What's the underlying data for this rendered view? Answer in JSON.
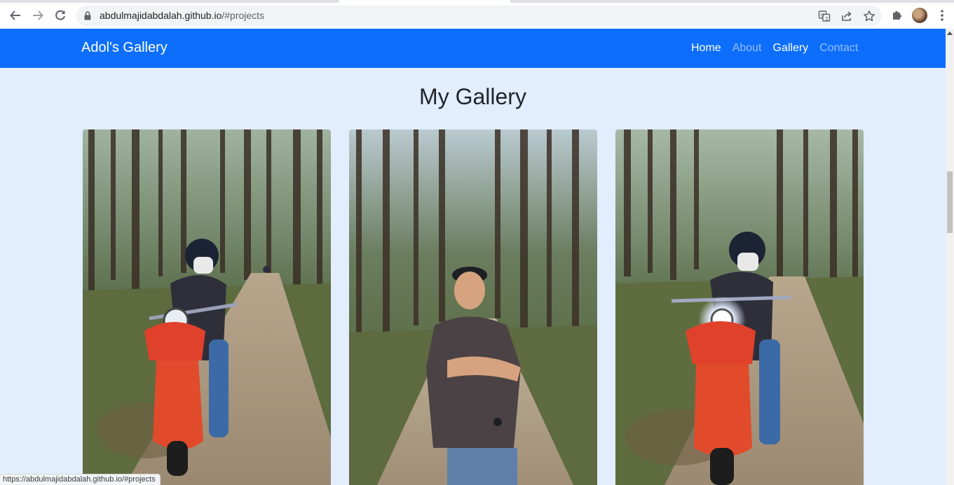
{
  "browser": {
    "url_host": "abdulmajidabdalah.github.io",
    "url_path": "/#projects",
    "status_url": "https://abdulmajidabdalah.github.io/#projects"
  },
  "site": {
    "brand": "Adol's Gallery",
    "nav": [
      {
        "label": "Home",
        "active": true
      },
      {
        "label": "About",
        "active": false
      },
      {
        "label": "Gallery",
        "active": true
      },
      {
        "label": "Contact",
        "active": false
      }
    ],
    "colors": {
      "navbar": "#0d6efd",
      "page_bg": "#e2edfd"
    }
  },
  "main": {
    "title": "My Gallery",
    "photos": [
      {
        "subject": "rider-on-red-scooter-forest-road"
      },
      {
        "subject": "man-standing-forest-road"
      },
      {
        "subject": "rider-on-red-scooter-headlight-on"
      }
    ]
  }
}
